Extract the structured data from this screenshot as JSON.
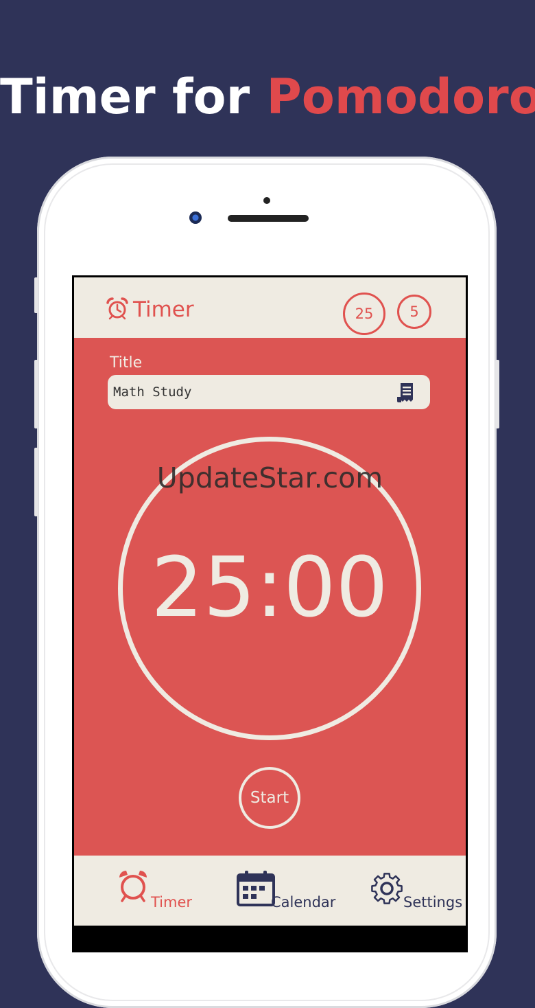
{
  "promo": {
    "headline_prefix": "Timer for",
    "headline_accent": "Pomodoro"
  },
  "header": {
    "title": "Timer",
    "work_minutes": "25",
    "break_minutes": "5"
  },
  "form": {
    "title_label": "Title",
    "title_value": "Math Study"
  },
  "watermark": "UpdateStar.com",
  "timer": {
    "display": "25:00",
    "start_label": "Start"
  },
  "tabs": [
    {
      "label": "Timer",
      "icon": "alarm-clock-icon",
      "active": true
    },
    {
      "label": "Calendar",
      "icon": "calendar-icon",
      "active": false
    },
    {
      "label": "Settings",
      "icon": "gear-icon",
      "active": false
    }
  ],
  "colors": {
    "background": "#2f3358",
    "accent": "#e0524f",
    "surface": "#efebe2",
    "main_red": "#dc5553"
  }
}
